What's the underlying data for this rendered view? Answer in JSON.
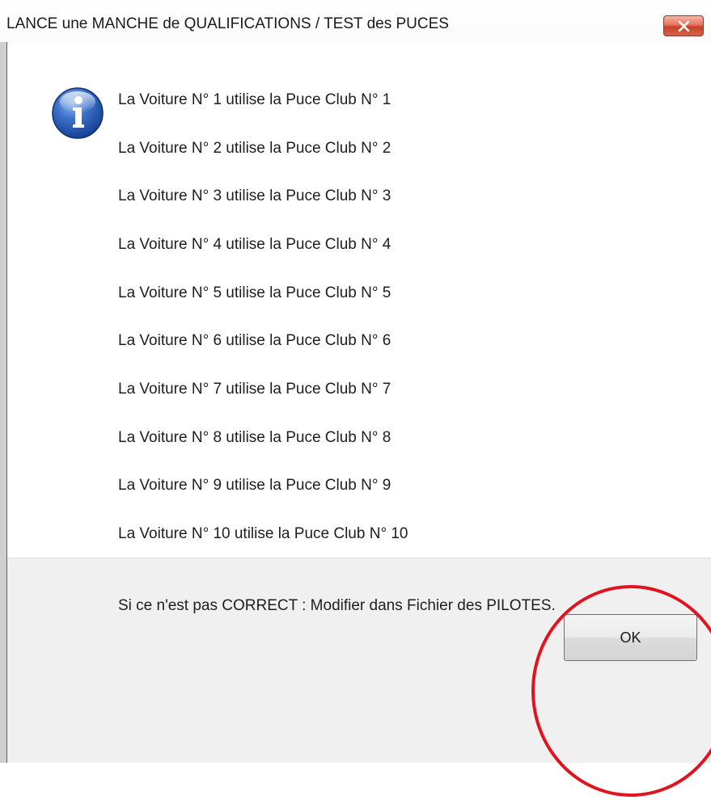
{
  "window": {
    "title": "LANCE une MANCHE de QUALIFICATIONS / TEST des PUCES",
    "close_icon": "close-x-icon"
  },
  "message": {
    "icon": "info-icon",
    "lines": [
      "La Voiture N° 1 utilise la Puce Club N° 1",
      "La Voiture N° 2 utilise la Puce Club N° 2",
      "La Voiture N° 3 utilise la Puce Club N° 3",
      "La Voiture N° 4 utilise la Puce Club N° 4",
      "La Voiture N° 5 utilise la Puce Club N° 5",
      "La Voiture N° 6 utilise la Puce Club N° 6",
      "La Voiture N° 7 utilise la Puce Club N° 7",
      "La Voiture N° 8 utilise la Puce Club N° 8",
      "La Voiture N° 9 utilise la Puce Club N° 9",
      "La Voiture N° 10 utilise la Puce Club N° 10"
    ],
    "note": "Si ce n'est pas CORRECT : Modifier dans Fichier des PILOTES."
  },
  "footer": {
    "ok_label": "OK"
  },
  "colors": {
    "annotation": "#e0141e",
    "close_button": "#d9614a",
    "footer_bg": "#f0f0f0"
  }
}
